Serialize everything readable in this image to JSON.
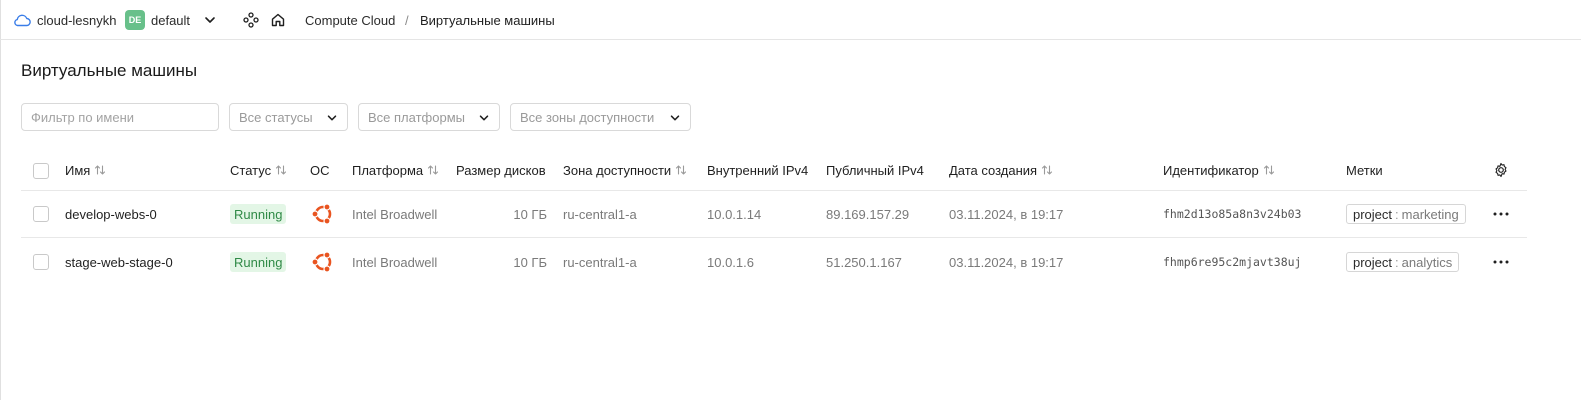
{
  "header": {
    "cloud_name": "cloud-lesnykh",
    "folder_badge": "DE",
    "folder_name": "default",
    "breadcrumb": {
      "service": "Compute Cloud",
      "separator": "/",
      "current": "Виртуальные машины"
    }
  },
  "page": {
    "title": "Виртуальные машины"
  },
  "filters": {
    "name_placeholder": "Фильтр по имени",
    "status": "Все статусы",
    "platform": "Все платформы",
    "zone": "Все зоны доступности"
  },
  "table": {
    "columns": {
      "name": "Имя",
      "status": "Статус",
      "os": "ОС",
      "platform": "Платформа",
      "disk_size": "Размер дисков",
      "zone": "Зона доступности",
      "internal_ip": "Внутренний IPv4",
      "public_ip": "Публичный IPv4",
      "created": "Дата создания",
      "id": "Идентификатор",
      "labels": "Метки"
    },
    "rows": [
      {
        "name": "develop-webs-0",
        "status": "Running",
        "os_icon": "ubuntu-icon",
        "platform": "Intel Broadwell",
        "disk_size": "10 ГБ",
        "zone": "ru-central1-a",
        "internal_ip": "10.0.1.14",
        "public_ip": "89.169.157.29",
        "created": "03.11.2024, в 19:17",
        "id": "fhm2d13o85a8n3v24b03",
        "label_key": "project",
        "label_sep": ":",
        "label_value": "marketing"
      },
      {
        "name": "stage-web-stage-0",
        "status": "Running",
        "os_icon": "ubuntu-icon",
        "platform": "Intel Broadwell",
        "disk_size": "10 ГБ",
        "zone": "ru-central1-a",
        "internal_ip": "10.0.1.6",
        "public_ip": "51.250.1.167",
        "created": "03.11.2024, в 19:17",
        "id": "fhmp6re95c2mjavt38uj",
        "label_key": "project",
        "label_sep": ":",
        "label_value": "analytics"
      }
    ]
  },
  "colors": {
    "accent": "#3a7de8",
    "running_bg": "#e3f6e6",
    "running_text": "#2f8a46",
    "ubuntu": "#e95420",
    "badge": "#68c08a"
  }
}
